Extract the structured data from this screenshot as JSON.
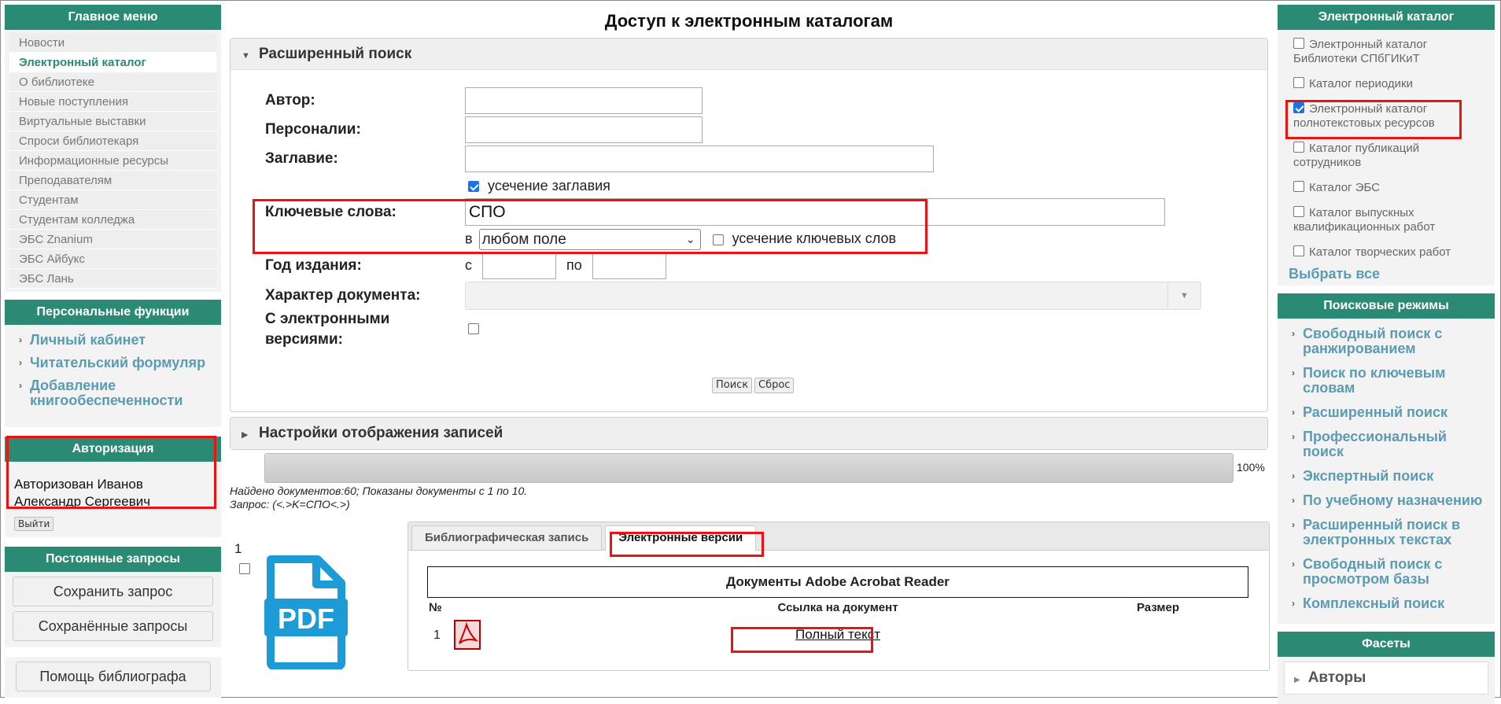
{
  "left": {
    "main_menu": {
      "title": "Главное меню",
      "items": [
        "Новости",
        "Электронный каталог",
        "О библиотеке",
        "Новые поступления",
        "Виртуальные выставки",
        "Спроси библиотекаря",
        "Информационные ресурсы",
        "Преподавателям",
        "Студентам",
        "Студентам колледжа",
        "ЭБС Znanium",
        "ЭБС Айбукс",
        "ЭБС Лань"
      ],
      "active": "Электронный каталог"
    },
    "personal": {
      "title": "Персональные функции",
      "items": [
        "Личный кабинет",
        "Читательский формуляр",
        "Добавление книгообеспеченности"
      ]
    },
    "auth": {
      "title": "Авторизация",
      "text": "Авторизован Иванов Александр Сергеевич",
      "logout": "Выйти"
    },
    "saved": {
      "title": "Постоянные запросы",
      "save": "Сохранить запрос",
      "saved": "Сохранённые запросы",
      "help": "Помощь библиографа"
    }
  },
  "center": {
    "title": "Доступ к электронным каталогам",
    "search_panel": {
      "title": "Расширенный поиск",
      "author_label": "Автор:",
      "person_label": "Персоналии:",
      "title_label": "Заглавие:",
      "truncate_title": "усечение заглавия",
      "keywords_label": "Ключевые слова:",
      "keywords_value": "СПО",
      "in_label": "в",
      "field_select": "любом поле",
      "truncate_keywords": "усечение ключевых слов",
      "year_label": "Год издания:",
      "from_label": "с",
      "to_label": "по",
      "doctype_label": "Характер документа:",
      "electronic_label": "С электронными версиями:",
      "search_btn": "Поиск",
      "reset_btn": "Сброс"
    },
    "display_panel": {
      "title": "Настройки отображения записей"
    },
    "progress": {
      "value": 100,
      "label": "100%"
    },
    "found": "Найдено документов:60; Показаны документы с 1 по 10.",
    "query": "Запрос:  (<.>K=СПО<.>)",
    "record": {
      "number": "1",
      "icon_text": "PDF",
      "tabs": [
        "Библиографическая запись",
        "Электронные версии"
      ],
      "active_tab": "Электронные версии",
      "table_title": "Документы Adobe Acrobat Reader",
      "col_no": "№",
      "col_link": "Ссылка на документ",
      "col_size": "Размер",
      "row_no": "1",
      "row_link": "Полный текст"
    }
  },
  "right": {
    "catalog": {
      "title": "Электронный каталог",
      "items": [
        {
          "label": "Электронный каталог Библиотеки СПбГИКиТ",
          "checked": false
        },
        {
          "label": "Каталог периодики",
          "checked": false
        },
        {
          "label": "Электронный каталог полнотекстовых ресурсов",
          "checked": true
        },
        {
          "label": "Каталог публикаций сотрудников",
          "checked": false
        },
        {
          "label": "Каталог ЭБС",
          "checked": false
        },
        {
          "label": "Каталог выпускных квалификационных работ",
          "checked": false
        },
        {
          "label": "Каталог творческих работ",
          "checked": false
        }
      ],
      "select_all": "Выбрать все"
    },
    "modes": {
      "title": "Поисковые режимы",
      "items": [
        "Свободный поиск с ранжированием",
        "Поиск по ключевым словам",
        "Расширенный поиск",
        "Профессиональный поиск",
        "Экспертный поиск",
        "По учебному назначению",
        "Расширенный поиск в электронных текстах",
        "Свободный поиск с просмотром базы",
        "Комплексный поиск"
      ]
    },
    "facets": {
      "title": "Фасеты",
      "authors": "Авторы"
    }
  },
  "colors": {
    "header_green": "#2b8a74",
    "link_blue": "#5b9bb4",
    "highlight_red": "#e11111"
  }
}
